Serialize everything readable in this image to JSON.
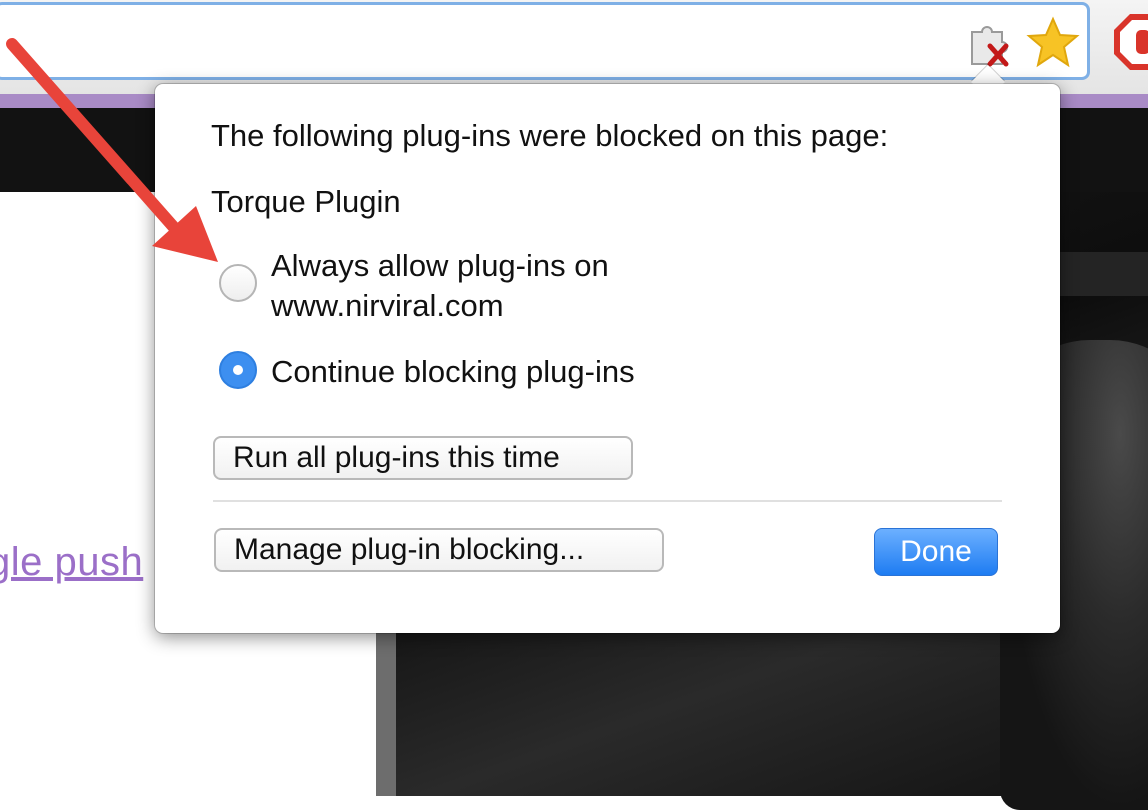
{
  "toolbar": {
    "icons": [
      "puzzle-blocked-icon",
      "star-icon",
      "stop-icon"
    ]
  },
  "page": {
    "link_text": "gle push"
  },
  "popup": {
    "title": "The following plug-ins were blocked on this page:",
    "plugin_name": "Torque Plugin",
    "options": [
      {
        "line1": "Always allow plug-ins on",
        "line2": "www.nirviral.com",
        "selected": false
      },
      {
        "label": "Continue blocking plug-ins",
        "selected": true
      }
    ],
    "run_all_button": "Run all plug-ins this time",
    "manage_button": "Manage plug-in blocking...",
    "done_button": "Done"
  },
  "colors": {
    "accent_strip": "#a98bc6",
    "done_button": "#1e7cf2",
    "annotation_arrow": "#e8443a",
    "link": "#9b6fc8"
  }
}
